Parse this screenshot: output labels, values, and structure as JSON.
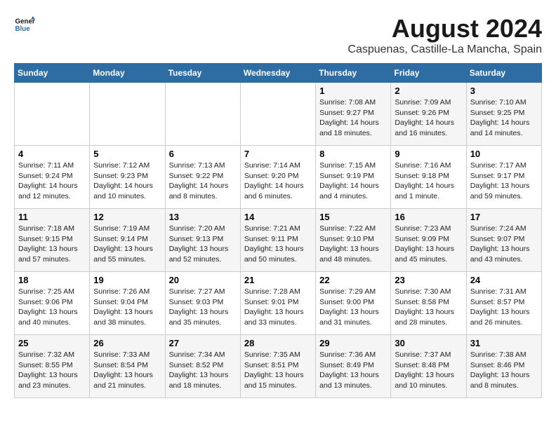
{
  "logo": {
    "line1": "General",
    "line2": "Blue"
  },
  "title": "August 2024",
  "location": "Caspuenas, Castille-La Mancha, Spain",
  "headers": [
    "Sunday",
    "Monday",
    "Tuesday",
    "Wednesday",
    "Thursday",
    "Friday",
    "Saturday"
  ],
  "weeks": [
    [
      {
        "day": "",
        "info": ""
      },
      {
        "day": "",
        "info": ""
      },
      {
        "day": "",
        "info": ""
      },
      {
        "day": "",
        "info": ""
      },
      {
        "day": "1",
        "info": "Sunrise: 7:08 AM\nSunset: 9:27 PM\nDaylight: 14 hours\nand 18 minutes."
      },
      {
        "day": "2",
        "info": "Sunrise: 7:09 AM\nSunset: 9:26 PM\nDaylight: 14 hours\nand 16 minutes."
      },
      {
        "day": "3",
        "info": "Sunrise: 7:10 AM\nSunset: 9:25 PM\nDaylight: 14 hours\nand 14 minutes."
      }
    ],
    [
      {
        "day": "4",
        "info": "Sunrise: 7:11 AM\nSunset: 9:24 PM\nDaylight: 14 hours\nand 12 minutes."
      },
      {
        "day": "5",
        "info": "Sunrise: 7:12 AM\nSunset: 9:23 PM\nDaylight: 14 hours\nand 10 minutes."
      },
      {
        "day": "6",
        "info": "Sunrise: 7:13 AM\nSunset: 9:22 PM\nDaylight: 14 hours\nand 8 minutes."
      },
      {
        "day": "7",
        "info": "Sunrise: 7:14 AM\nSunset: 9:20 PM\nDaylight: 14 hours\nand 6 minutes."
      },
      {
        "day": "8",
        "info": "Sunrise: 7:15 AM\nSunset: 9:19 PM\nDaylight: 14 hours\nand 4 minutes."
      },
      {
        "day": "9",
        "info": "Sunrise: 7:16 AM\nSunset: 9:18 PM\nDaylight: 14 hours\nand 1 minute."
      },
      {
        "day": "10",
        "info": "Sunrise: 7:17 AM\nSunset: 9:17 PM\nDaylight: 13 hours\nand 59 minutes."
      }
    ],
    [
      {
        "day": "11",
        "info": "Sunrise: 7:18 AM\nSunset: 9:15 PM\nDaylight: 13 hours\nand 57 minutes."
      },
      {
        "day": "12",
        "info": "Sunrise: 7:19 AM\nSunset: 9:14 PM\nDaylight: 13 hours\nand 55 minutes."
      },
      {
        "day": "13",
        "info": "Sunrise: 7:20 AM\nSunset: 9:13 PM\nDaylight: 13 hours\nand 52 minutes."
      },
      {
        "day": "14",
        "info": "Sunrise: 7:21 AM\nSunset: 9:11 PM\nDaylight: 13 hours\nand 50 minutes."
      },
      {
        "day": "15",
        "info": "Sunrise: 7:22 AM\nSunset: 9:10 PM\nDaylight: 13 hours\nand 48 minutes."
      },
      {
        "day": "16",
        "info": "Sunrise: 7:23 AM\nSunset: 9:09 PM\nDaylight: 13 hours\nand 45 minutes."
      },
      {
        "day": "17",
        "info": "Sunrise: 7:24 AM\nSunset: 9:07 PM\nDaylight: 13 hours\nand 43 minutes."
      }
    ],
    [
      {
        "day": "18",
        "info": "Sunrise: 7:25 AM\nSunset: 9:06 PM\nDaylight: 13 hours\nand 40 minutes."
      },
      {
        "day": "19",
        "info": "Sunrise: 7:26 AM\nSunset: 9:04 PM\nDaylight: 13 hours\nand 38 minutes."
      },
      {
        "day": "20",
        "info": "Sunrise: 7:27 AM\nSunset: 9:03 PM\nDaylight: 13 hours\nand 35 minutes."
      },
      {
        "day": "21",
        "info": "Sunrise: 7:28 AM\nSunset: 9:01 PM\nDaylight: 13 hours\nand 33 minutes."
      },
      {
        "day": "22",
        "info": "Sunrise: 7:29 AM\nSunset: 9:00 PM\nDaylight: 13 hours\nand 31 minutes."
      },
      {
        "day": "23",
        "info": "Sunrise: 7:30 AM\nSunset: 8:58 PM\nDaylight: 13 hours\nand 28 minutes."
      },
      {
        "day": "24",
        "info": "Sunrise: 7:31 AM\nSunset: 8:57 PM\nDaylight: 13 hours\nand 26 minutes."
      }
    ],
    [
      {
        "day": "25",
        "info": "Sunrise: 7:32 AM\nSunset: 8:55 PM\nDaylight: 13 hours\nand 23 minutes."
      },
      {
        "day": "26",
        "info": "Sunrise: 7:33 AM\nSunset: 8:54 PM\nDaylight: 13 hours\nand 21 minutes."
      },
      {
        "day": "27",
        "info": "Sunrise: 7:34 AM\nSunset: 8:52 PM\nDaylight: 13 hours\nand 18 minutes."
      },
      {
        "day": "28",
        "info": "Sunrise: 7:35 AM\nSunset: 8:51 PM\nDaylight: 13 hours\nand 15 minutes."
      },
      {
        "day": "29",
        "info": "Sunrise: 7:36 AM\nSunset: 8:49 PM\nDaylight: 13 hours\nand 13 minutes."
      },
      {
        "day": "30",
        "info": "Sunrise: 7:37 AM\nSunset: 8:48 PM\nDaylight: 13 hours\nand 10 minutes."
      },
      {
        "day": "31",
        "info": "Sunrise: 7:38 AM\nSunset: 8:46 PM\nDaylight: 13 hours\nand 8 minutes."
      }
    ]
  ]
}
